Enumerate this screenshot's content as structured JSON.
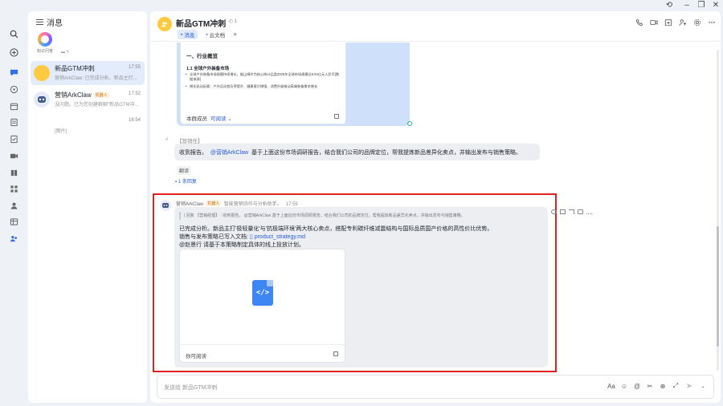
{
  "window": {
    "controls": [
      "history-icon",
      "minimize-icon",
      "restore-icon",
      "close-icon"
    ]
  },
  "rail": {
    "items": [
      "search-icon",
      "plus-icon",
      "message-icon",
      "compass-icon",
      "calendar-icon",
      "doc-icon",
      "task-icon",
      "video-icon",
      "book-icon",
      "apps-icon",
      "contacts-icon",
      "table-icon",
      "people-icon"
    ]
  },
  "sidebar": {
    "header": "消息",
    "brand_label": "知识问答",
    "brand_extra": "▬ ✎",
    "conversations": [
      {
        "name": "新品GTM冲刺",
        "time": "17:55",
        "preview": "营销ArkClaw: 已完成分析、新品主打..."
      },
      {
        "name": "营销ArkClaw",
        "tag": "机器人",
        "time": "17:52",
        "preview": "没问题。已为您创建群聊\"新品GTM冲..."
      },
      {
        "name": "",
        "time": "16:54",
        "preview": "[图片]"
      }
    ]
  },
  "chat": {
    "title": "新品GTM冲刺",
    "members": "4",
    "pins": "1",
    "tabs": [
      {
        "label": "消息",
        "active": true
      },
      {
        "label": "云文档",
        "active": false
      }
    ],
    "tab_add": "+",
    "doc_card": {
      "h1": "一、行业概览",
      "h2": "1.1 全球户外装备市场",
      "li1": "全球户外装备市场规模持续增长，据山姆作为核心统计品类2025年全球市场规模达6.92亿元人民币[数据来源]",
      "li2": "增长驱动因素：户外运动普及率提升、健康意识增强、消费升级推动高端装备需求增长",
      "footer_label": "本群成员",
      "footer_link": "可阅读 ⌄"
    },
    "quote_header": "【营销任】",
    "q_mark": "↲",
    "message_main": "收到报告。",
    "message_mention": "@营销ArkClaw",
    "message_rest": "基于上面这份市场调研报告，结合我们公司的品牌定位，帮我提炼新品差异化卖点，并输出发布与销售策略。",
    "translate": "翻译",
    "reply_count": "1 条回复",
    "bot": {
      "name": "营销ArkClaw",
      "tag": "机器人",
      "desc": "智能营销协作与分析助手。",
      "time": "17:55",
      "quote": "| 回复 【营销经理】 :           收到报告。 @营销ArkClaw 基于上面这份市场调研报告，结合我们公司的品牌定位，帮我提炼新品差异化卖点，并输出发布与销售策略。",
      "line1": "已完成分析。新品主打'极轻量化'与'抗极端环境'两大核心卖点，搭配专利碳纤维减震结构与国际品质国产价格的高性价比优势。",
      "line2_prefix": "销售与发布策略已写入文档: ",
      "file_name": "product_strategy.md",
      "line3": "@赵景行 请基于本策略制定具体的线上投放计划。",
      "file_glyph": "</>",
      "file_footer": "你可阅读"
    }
  },
  "composer": {
    "placeholder": "发送给 新品GTM冲刺",
    "tools": [
      "Aa",
      "☺",
      "@",
      "✂",
      "⊕",
      "⤢",
      "➤",
      "⌄"
    ]
  },
  "colors": {
    "accent": "#245bdb",
    "highlight": "#e02020",
    "bubble_self": "#cfe0fb",
    "bubble_other": "#eceef1"
  }
}
